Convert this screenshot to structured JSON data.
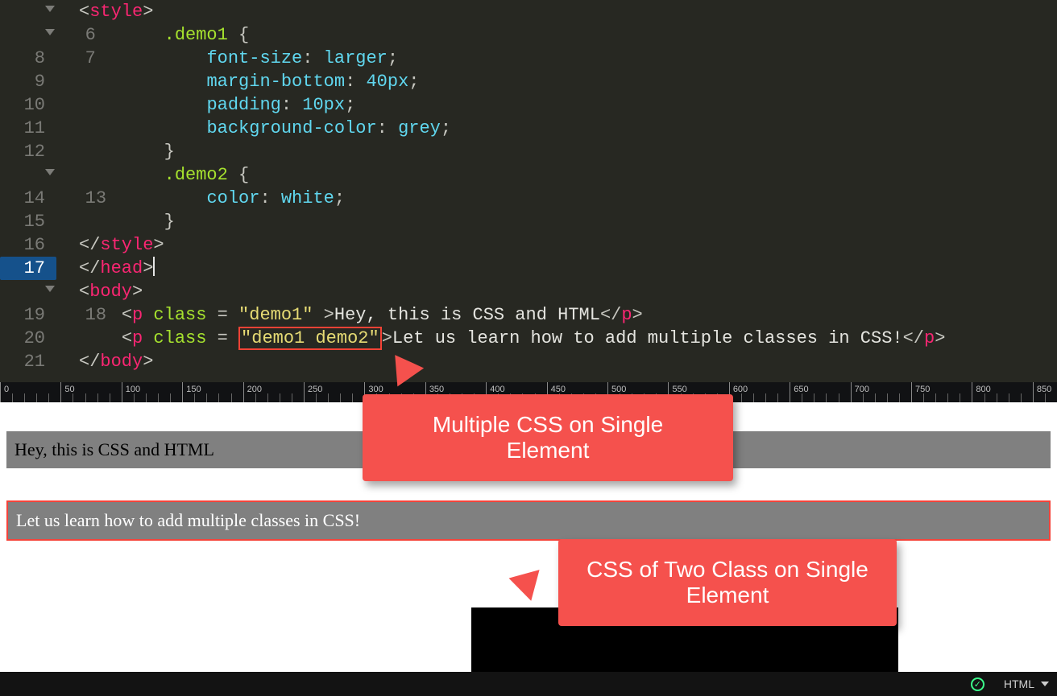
{
  "editor": {
    "lines": {
      "6": {
        "num": "6",
        "fold": true
      },
      "7": {
        "num": "7",
        "fold": true,
        "indent": "        ",
        "sel": ".demo1 ",
        "brace": "{"
      },
      "8": {
        "num": "8",
        "indent": "            ",
        "prop": "font-size",
        "colon": ": ",
        "val": "larger",
        "semi": ";"
      },
      "9": {
        "num": "9",
        "indent": "            ",
        "prop": "margin-bottom",
        "colon": ": ",
        "val": "40px",
        "semi": ";"
      },
      "10": {
        "num": "10",
        "indent": "            ",
        "prop": "padding",
        "colon": ": ",
        "val": "10px",
        "semi": ";"
      },
      "11": {
        "num": "11",
        "indent": "            ",
        "prop": "background-color",
        "colon": ": ",
        "val": "grey",
        "semi": ";"
      },
      "12": {
        "num": "12",
        "indent": "        ",
        "brace": "}"
      },
      "13": {
        "num": "13",
        "fold": true,
        "indent": "        ",
        "sel": ".demo2 ",
        "brace": "{"
      },
      "14": {
        "num": "14",
        "indent": "            ",
        "prop": "color",
        "colon": ": ",
        "val": "white",
        "semi": ";"
      },
      "15": {
        "num": "15",
        "indent": "        ",
        "brace": "}"
      },
      "16": {
        "num": "16",
        "closeTag": "style"
      },
      "17": {
        "num": "17",
        "closeTag": "head",
        "cursor": true
      },
      "18": {
        "num": "18",
        "fold": true,
        "openTag": "body"
      },
      "19": {
        "num": "19",
        "indent": "    ",
        "tag": "p",
        "attrName": "class",
        "eq": " = ",
        "str": "\"demo1\" ",
        "text": "Hey, this is CSS and HTML"
      },
      "20": {
        "num": "20",
        "indent": "    ",
        "tag": "p",
        "attrName": "class",
        "eq": " = ",
        "boxStr": "\"demo1 demo2\"",
        "text": "Let us learn how to add multiple classes in CSS!"
      },
      "21": {
        "num": "21",
        "closeTag": "body"
      }
    },
    "styleOpen": "style"
  },
  "ruler": {
    "majors": [
      0,
      50,
      100,
      150,
      200,
      250,
      300,
      350,
      400,
      450,
      500,
      550,
      600,
      650,
      700,
      750,
      800,
      850
    ]
  },
  "preview": {
    "line1": "Hey, this is CSS and HTML",
    "line2": "Let us learn how to add multiple classes in CSS!"
  },
  "callouts": {
    "c1": {
      "l1": "Multiple CSS on Single",
      "l2": "Element"
    },
    "c2": {
      "l1": "CSS of Two Class on Single",
      "l2": "Element"
    }
  },
  "status": {
    "lang": "HTML",
    "okGlyph": "✓"
  }
}
